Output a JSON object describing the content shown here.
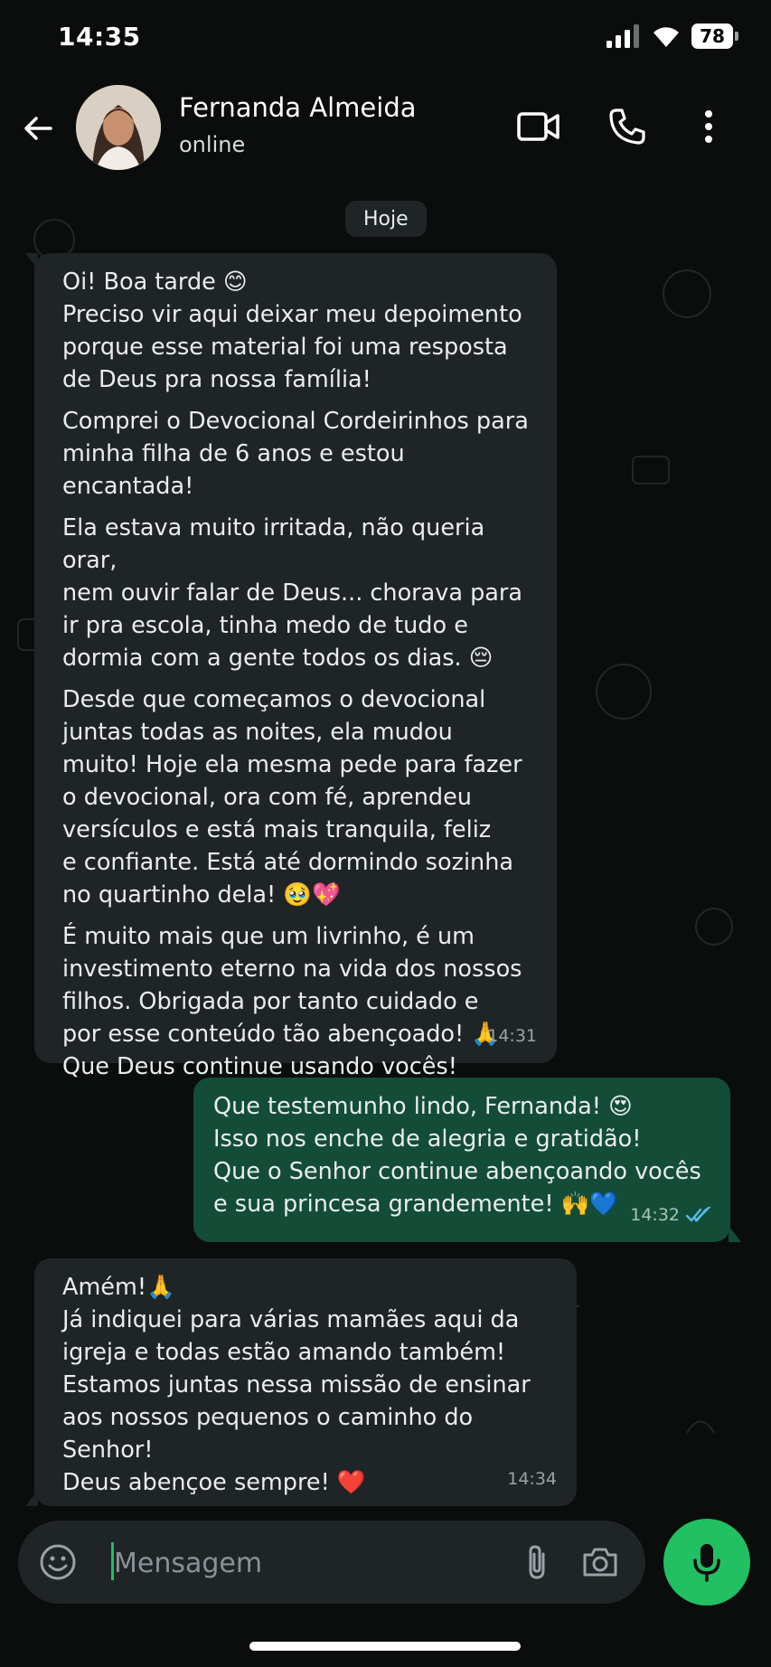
{
  "status_bar": {
    "time": "14:35",
    "battery": "78"
  },
  "header": {
    "contact_name": "Fernanda Almeida",
    "contact_status": "online"
  },
  "date_chip": "Hoje",
  "messages": [
    {
      "direction": "incoming",
      "paragraphs": [
        "Oi! Boa tarde 😊\nPreciso vir aqui deixar meu depoimento\nporque esse material foi uma resposta\nde Deus pra nossa família!",
        "Comprei o Devocional Cordeirinhos para\nminha filha de 6 anos e estou encantada!",
        "Ela estava muito irritada, não queria orar,\nnem ouvir falar de Deus... chorava para\nir pra escola, tinha medo de tudo e\ndormia com a gente todos os dias. 😔",
        "Desde que começamos o devocional\njuntas todas as noites, ela mudou\nmuito! Hoje ela mesma pede para fazer\no devocional, ora com fé, aprendeu\nversículos e está mais tranquila, feliz\ne confiante. Está até dormindo sozinha\nno quartinho dela! 🥹💖",
        "É muito mais que um livrinho, é um\ninvestimento eterno na vida dos nossos\nfilhos. Obrigada por tanto cuidado e\npor esse conteúdo tão abençoado! 🙏\nQue Deus continue usando vocês!"
      ],
      "time": "14:31"
    },
    {
      "direction": "outgoing",
      "paragraphs": [
        "Que testemunho lindo, Fernanda! 😍\nIsso nos enche de alegria e gratidão!\nQue o Senhor continue abençoando vocês\ne sua princesa grandemente! 🙌💙"
      ],
      "time": "14:32",
      "read": true
    },
    {
      "direction": "incoming",
      "paragraphs": [
        "Amém!🙏\nJá indiquei para várias mamães aqui da\nigreja e todas estão amando também!\nEstamos juntas nessa missão de ensinar\naos nossos pequenos o caminho do Senhor!\nDeus abençoe sempre! ❤️"
      ],
      "time": "14:34"
    }
  ],
  "composer": {
    "placeholder": "Mensagem"
  },
  "icons": {
    "back": "arrow-left-icon",
    "video": "video-camera-icon",
    "call": "phone-icon",
    "menu": "more-vertical-icon",
    "emoji": "smiley-icon",
    "attach": "paperclip-icon",
    "camera": "camera-icon",
    "mic": "microphone-icon"
  },
  "colors": {
    "accent": "#21c063",
    "incoming_bubble": "#1f2427",
    "outgoing_bubble": "#134d37",
    "read_ticks": "#53bdeb"
  }
}
